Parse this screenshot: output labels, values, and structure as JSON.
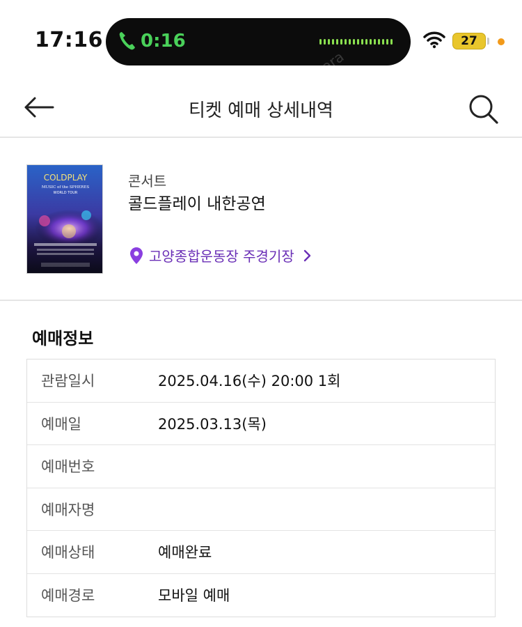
{
  "status_bar": {
    "time": "17:16",
    "call_timer": "0:16",
    "battery": "27",
    "watermark": "mara"
  },
  "header": {
    "title": "티켓 예매 상세내역",
    "back_icon": "arrow-left-icon",
    "search_icon": "search-icon"
  },
  "event": {
    "category": "콘서트",
    "title": "콜드플레이 내한공연",
    "venue": "고양종합운동장 주경기장",
    "poster": {
      "band": "COLDPLAY",
      "tour": "MUSIC of the SPHERES",
      "subtitle": "WORLD TOUR"
    }
  },
  "booking": {
    "section_title": "예매정보",
    "rows": [
      {
        "label": "관람일시",
        "value": "2025.04.16(수) 20:00 1회"
      },
      {
        "label": "예매일",
        "value": "2025.03.13(목)"
      },
      {
        "label": "예매번호",
        "value": ""
      },
      {
        "label": "예매자명",
        "value": ""
      },
      {
        "label": "예매상태",
        "value": "예매완료"
      },
      {
        "label": "예매경로",
        "value": "모바일 예매"
      }
    ]
  },
  "colors": {
    "accent": "#6a2fb6",
    "call_green": "#4ad15a",
    "battery_yellow": "#e9c62c",
    "divider": "#e5e5e5"
  }
}
